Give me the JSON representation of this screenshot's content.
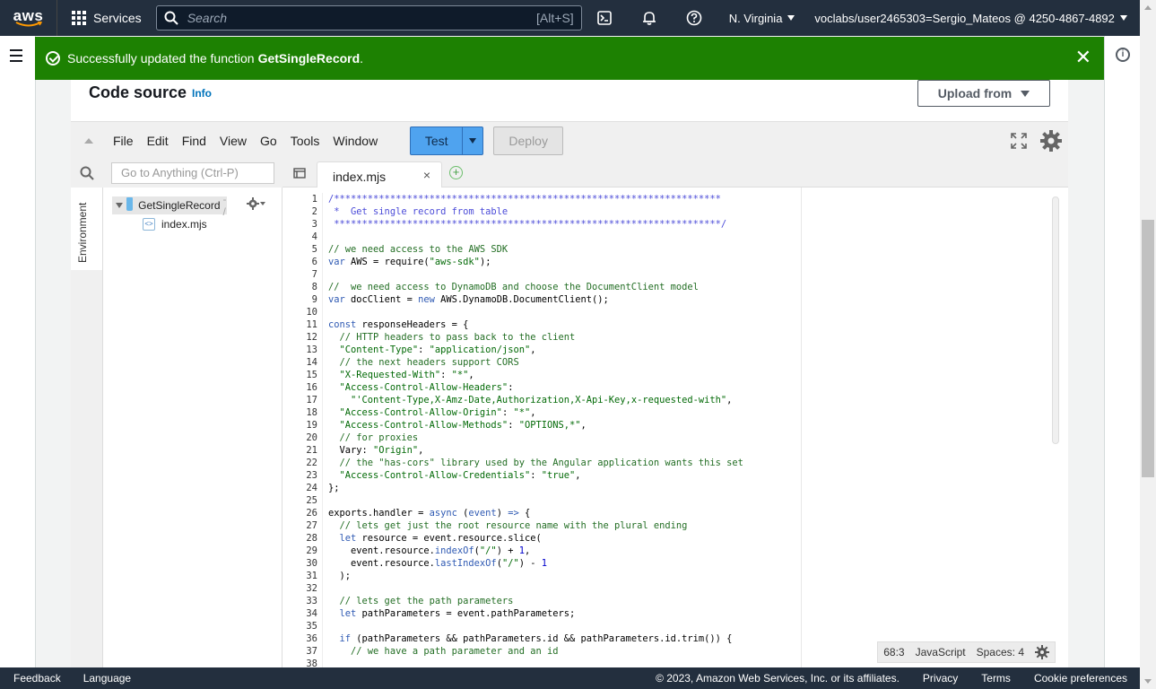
{
  "topnav": {
    "logo_text": "aws",
    "services_label": "Services",
    "search_placeholder": "Search",
    "search_shortcut": "[Alt+S]",
    "region": "N. Virginia",
    "account": "voclabs/user2465303=Sergio_Mateos @ 4250-4867-4892"
  },
  "flash": {
    "message": "Successfully updated the function",
    "function_name": "GetSingleRecord",
    "period": "."
  },
  "panel": {
    "title": "Code source",
    "info_link": "Info",
    "upload_label": "Upload from"
  },
  "toolbar": {
    "menus": [
      "File",
      "Edit",
      "Find",
      "View",
      "Go",
      "Tools",
      "Window"
    ],
    "test_label": "Test",
    "deploy_label": "Deploy"
  },
  "sidebar": {
    "goto_placeholder": "Go to Anything (Ctrl-P)",
    "environment_tab": "Environment",
    "folder_name": "GetSingleRecord",
    "folder_suffix": "- /",
    "file_name": "index.mjs"
  },
  "editor": {
    "tab_name": "index.mjs",
    "status": {
      "position": "68:3",
      "language": "JavaScript",
      "spaces": "Spaces: 4"
    },
    "line_numbers": [
      "1",
      "2",
      "3",
      "4",
      "5",
      "6",
      "7",
      "8",
      "9",
      "10",
      "11",
      "12",
      "13",
      "14",
      "15",
      "16",
      "17",
      "18",
      "19",
      "20",
      "21",
      "22",
      "23",
      "24",
      "25",
      "26",
      "27",
      "28",
      "29",
      "30",
      "31",
      "32",
      "33",
      "34",
      "35",
      "36",
      "37",
      "38"
    ],
    "lines": [
      [
        {
          "t": "/*********************************************************************",
          "c": "cmb"
        }
      ],
      [
        {
          "t": " *  Get single record from table",
          "c": "cmb"
        }
      ],
      [
        {
          "t": " *********************************************************************/",
          "c": "cmb"
        }
      ],
      [
        {
          "t": "",
          "c": ""
        }
      ],
      [
        {
          "t": "// we need access to the AWS SDK",
          "c": "cm"
        }
      ],
      [
        {
          "t": "var",
          "c": "kw"
        },
        {
          "t": " AWS = require(",
          "c": ""
        },
        {
          "t": "\"aws-sdk\"",
          "c": "str"
        },
        {
          "t": ");",
          "c": ""
        }
      ],
      [
        {
          "t": "",
          "c": ""
        }
      ],
      [
        {
          "t": "//  we need access to DynamoDB and choose the DocumentClient model",
          "c": "cm"
        }
      ],
      [
        {
          "t": "var",
          "c": "kw"
        },
        {
          "t": " docClient = ",
          "c": ""
        },
        {
          "t": "new",
          "c": "kw"
        },
        {
          "t": " AWS.DynamoDB.DocumentClient();",
          "c": ""
        }
      ],
      [
        {
          "t": "",
          "c": ""
        }
      ],
      [
        {
          "t": "const",
          "c": "kw"
        },
        {
          "t": " responseHeaders = {",
          "c": ""
        }
      ],
      [
        {
          "t": "  // HTTP headers to pass back to the client",
          "c": "cm"
        }
      ],
      [
        {
          "t": "  ",
          "c": ""
        },
        {
          "t": "\"Content-Type\"",
          "c": "str"
        },
        {
          "t": ": ",
          "c": ""
        },
        {
          "t": "\"application/json\"",
          "c": "str"
        },
        {
          "t": ",",
          "c": ""
        }
      ],
      [
        {
          "t": "  // the next headers support CORS",
          "c": "cm"
        }
      ],
      [
        {
          "t": "  ",
          "c": ""
        },
        {
          "t": "\"X-Requested-With\"",
          "c": "str"
        },
        {
          "t": ": ",
          "c": ""
        },
        {
          "t": "\"*\"",
          "c": "str"
        },
        {
          "t": ",",
          "c": ""
        }
      ],
      [
        {
          "t": "  ",
          "c": ""
        },
        {
          "t": "\"Access-Control-Allow-Headers\"",
          "c": "str"
        },
        {
          "t": ":",
          "c": ""
        }
      ],
      [
        {
          "t": "    ",
          "c": ""
        },
        {
          "t": "\"'Content-Type,X-Amz-Date,Authorization,X-Api-Key,x-requested-with\"",
          "c": "str"
        },
        {
          "t": ",",
          "c": ""
        }
      ],
      [
        {
          "t": "  ",
          "c": ""
        },
        {
          "t": "\"Access-Control-Allow-Origin\"",
          "c": "str"
        },
        {
          "t": ": ",
          "c": ""
        },
        {
          "t": "\"*\"",
          "c": "str"
        },
        {
          "t": ",",
          "c": ""
        }
      ],
      [
        {
          "t": "  ",
          "c": ""
        },
        {
          "t": "\"Access-Control-Allow-Methods\"",
          "c": "str"
        },
        {
          "t": ": ",
          "c": ""
        },
        {
          "t": "\"OPTIONS,*\"",
          "c": "str"
        },
        {
          "t": ",",
          "c": ""
        }
      ],
      [
        {
          "t": "  // for proxies",
          "c": "cm"
        }
      ],
      [
        {
          "t": "  Vary: ",
          "c": ""
        },
        {
          "t": "\"Origin\"",
          "c": "str"
        },
        {
          "t": ",",
          "c": ""
        }
      ],
      [
        {
          "t": "  // the \"has-cors\" library used by the Angular application wants this set",
          "c": "cm"
        }
      ],
      [
        {
          "t": "  ",
          "c": ""
        },
        {
          "t": "\"Access-Control-Allow-Credentials\"",
          "c": "str"
        },
        {
          "t": ": ",
          "c": ""
        },
        {
          "t": "\"true\"",
          "c": "str"
        },
        {
          "t": ",",
          "c": ""
        }
      ],
      [
        {
          "t": "};",
          "c": ""
        }
      ],
      [
        {
          "t": "",
          "c": ""
        }
      ],
      [
        {
          "t": "exports.handler = ",
          "c": ""
        },
        {
          "t": "async",
          "c": "kw"
        },
        {
          "t": " (",
          "c": ""
        },
        {
          "t": "event",
          "c": "kw"
        },
        {
          "t": ") ",
          "c": ""
        },
        {
          "t": "=>",
          "c": "kw"
        },
        {
          "t": " {",
          "c": ""
        }
      ],
      [
        {
          "t": "  // lets get just the root resource name with the plural ending",
          "c": "cm"
        }
      ],
      [
        {
          "t": "  ",
          "c": ""
        },
        {
          "t": "let",
          "c": "kw"
        },
        {
          "t": " resource = event.resource.slice(",
          "c": ""
        }
      ],
      [
        {
          "t": "    event.resource.",
          "c": ""
        },
        {
          "t": "indexOf",
          "c": "kw"
        },
        {
          "t": "(",
          "c": ""
        },
        {
          "t": "\"/\"",
          "c": "str"
        },
        {
          "t": ") + ",
          "c": ""
        },
        {
          "t": "1",
          "c": "num"
        },
        {
          "t": ",",
          "c": ""
        }
      ],
      [
        {
          "t": "    event.resource.",
          "c": ""
        },
        {
          "t": "lastIndexOf",
          "c": "kw"
        },
        {
          "t": "(",
          "c": ""
        },
        {
          "t": "\"/\"",
          "c": "str"
        },
        {
          "t": ") - ",
          "c": ""
        },
        {
          "t": "1",
          "c": "num"
        }
      ],
      [
        {
          "t": "  );",
          "c": ""
        }
      ],
      [
        {
          "t": "",
          "c": ""
        }
      ],
      [
        {
          "t": "  // lets get the path parameters",
          "c": "cm"
        }
      ],
      [
        {
          "t": "  ",
          "c": ""
        },
        {
          "t": "let",
          "c": "kw"
        },
        {
          "t": " pathParameters = event.pathParameters;",
          "c": ""
        }
      ],
      [
        {
          "t": "",
          "c": ""
        }
      ],
      [
        {
          "t": "  ",
          "c": ""
        },
        {
          "t": "if",
          "c": "kw"
        },
        {
          "t": " (pathParameters && pathParameters.id && pathParameters.id.trim()) {",
          "c": ""
        }
      ],
      [
        {
          "t": "    // we have a path parameter and an id",
          "c": "cm"
        }
      ],
      [
        {
          "t": "",
          "c": ""
        }
      ]
    ]
  },
  "footer": {
    "feedback": "Feedback",
    "language": "Language",
    "copyright": "© 2023, Amazon Web Services, Inc. or its affiliates.",
    "privacy": "Privacy",
    "terms": "Terms",
    "cookies": "Cookie preferences"
  }
}
